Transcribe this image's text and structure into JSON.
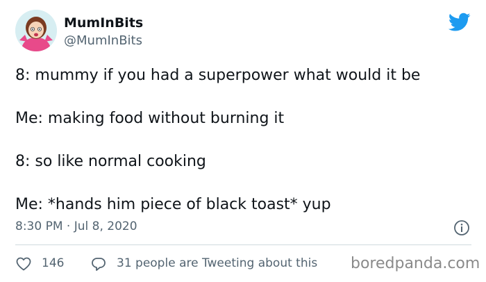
{
  "author": {
    "display_name": "MumInBits",
    "handle": "@MumInBits"
  },
  "tweet": {
    "lines": [
      "8: mummy if you had a superpower what would it be",
      "Me: making food without burning it",
      "8: so like normal cooking",
      "Me: *hands him piece of black toast* yup"
    ],
    "timestamp": "8:30 PM · Jul 8, 2020"
  },
  "actions": {
    "like_count": "146",
    "replies_text": "31 people are Tweeting about this"
  },
  "watermark": "boredpanda.com",
  "colors": {
    "twitter_blue": "#1d9bf0",
    "text_primary": "#0f1419",
    "text_secondary": "#536471",
    "divider": "#cfd9de"
  },
  "icons": [
    "twitter-bird-icon",
    "info-icon",
    "heart-icon",
    "reply-bubble-icon"
  ]
}
